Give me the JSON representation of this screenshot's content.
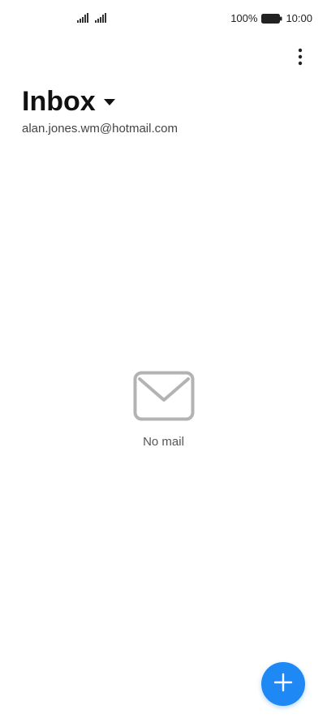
{
  "status_bar": {
    "battery_percent": "100%",
    "time": "10:00",
    "icons": [
      "signal-icon",
      "signal-icon",
      "battery-icon"
    ]
  },
  "toolbar": {
    "more_icon": "more-vertical-icon"
  },
  "header": {
    "title": "Inbox",
    "dropdown_icon": "caret-down-icon",
    "account": "alan.jones.wm@hotmail.com"
  },
  "empty_state": {
    "icon": "envelope-icon",
    "message": "No mail"
  },
  "fab": {
    "icon": "plus-icon",
    "color": "#1e88f5"
  }
}
